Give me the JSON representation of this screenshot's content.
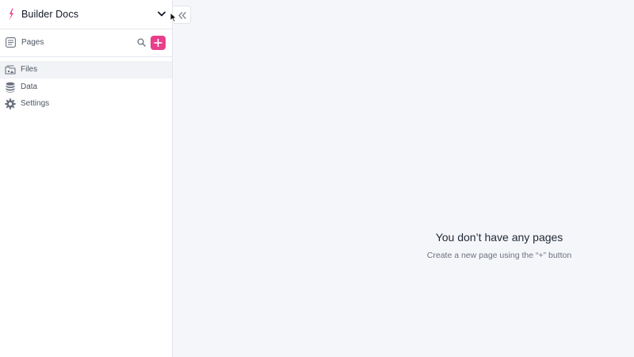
{
  "workspace": {
    "name": "Builder Docs"
  },
  "pages_section": {
    "label": "Pages"
  },
  "nav": {
    "items": [
      {
        "label": "Files",
        "icon": "files-icon",
        "active": true
      },
      {
        "label": "Data",
        "icon": "database-icon",
        "active": false
      },
      {
        "label": "Settings",
        "icon": "gear-icon",
        "active": false
      }
    ]
  },
  "empty_state": {
    "title": "You don’t have any pages",
    "subtitle": "Create a new page using the “+” button"
  },
  "colors": {
    "accent": "#e83e8c",
    "sidebar_bg": "#ffffff",
    "canvas_bg": "#f5f6f9"
  }
}
